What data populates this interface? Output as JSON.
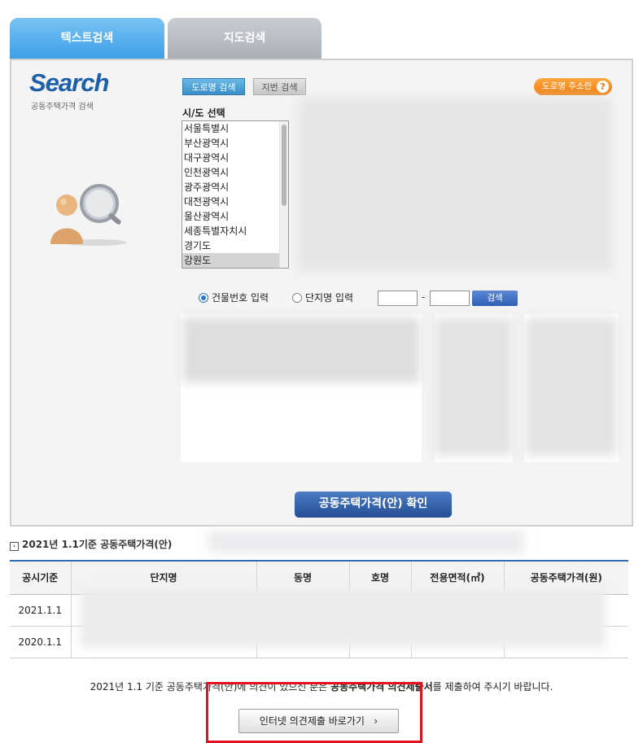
{
  "tabs": [
    {
      "label": "텍스트검색",
      "active": true
    },
    {
      "label": "지도검색",
      "active": false
    }
  ],
  "logo": {
    "title": "Search",
    "subtitle": "공동주택가격 검색"
  },
  "search_mode": {
    "road_label": "도로명 검색",
    "lot_label": "지번 검색"
  },
  "address_help": {
    "label": "도로명 주소란",
    "icon": "question-icon"
  },
  "sido": {
    "label": "시/도 선택",
    "items": [
      "서울특별시",
      "부산광역시",
      "대구광역시",
      "인천광역시",
      "광주광역시",
      "대전광역시",
      "울산광역시",
      "세종특별자치시",
      "경기도",
      "강원도"
    ],
    "selected": "강원도"
  },
  "input_type": {
    "building_label": "건물번호 입력",
    "complex_label": "단지명 입력",
    "selected": "건물번호 입력",
    "search_label": "검색",
    "separator": "-"
  },
  "confirm_label": "공동주택가격(안) 확인",
  "section_title": "2021년 1.1기준 공동주택가격(안)",
  "table": {
    "headers": [
      "공시기준",
      "단지명",
      "동명",
      "호명",
      "전용면적(㎡)",
      "공동주택가격(원)"
    ],
    "rows": [
      {
        "base": "2021.1.1"
      },
      {
        "base": "2020.1.1"
      }
    ]
  },
  "notice": {
    "prefix": "2021년 1.1 기준 공동주택가격(안)에 의견이 있으신 분은 ",
    "bold": "공동주택가격 의견제출서",
    "suffix": "를 제출하여 주시기 바랍니다."
  },
  "submit_label": "인터넷 의견제출 바로가기",
  "submit_arrow": "›",
  "colors": {
    "accent": "#2e6db4",
    "tab_active": "#4aa6ea",
    "help": "#f08a1a",
    "highlight": "#e0121d"
  }
}
